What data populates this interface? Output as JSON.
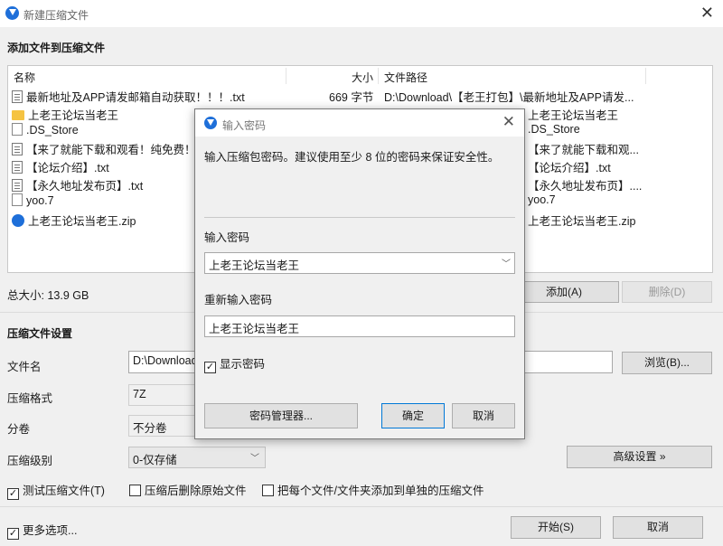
{
  "window": {
    "title": "新建压缩文件",
    "app_icon": "bandizip-icon",
    "close": "✕"
  },
  "files_section": {
    "title": "添加文件到压缩文件"
  },
  "columns": {
    "name": "名称",
    "size": "大小",
    "path": "文件路径"
  },
  "files": [
    {
      "icon": "text-file-icon",
      "name": "最新地址及APP请发邮箱自动获取！！！.txt",
      "size": "669 字节",
      "path": "D:\\Download\\【老王打包】\\最新地址及APP请发..."
    },
    {
      "icon": "folder-icon",
      "name": "上老王论坛当老王",
      "size": "",
      "path": "上老王论坛当老王"
    },
    {
      "icon": "blank-file-icon",
      "name": ".DS_Store",
      "size": "",
      "path": ".DS_Store"
    },
    {
      "icon": "text-file-icon",
      "name": "【来了就能下载和观看！纯免费！",
      "size": "",
      "path": "【来了就能下载和观..."
    },
    {
      "icon": "text-file-icon",
      "name": "【论坛介绍】.txt",
      "size": "",
      "path": "【论坛介绍】.txt"
    },
    {
      "icon": "text-file-icon",
      "name": "【永久地址发布页】.txt",
      "size": "",
      "path": "【永久地址发布页】...."
    },
    {
      "icon": "blank-file-icon",
      "name": "yoo.7",
      "size": "",
      "path": "yoo.7"
    },
    {
      "icon": "zip-file-icon",
      "name": "上老王论坛当老王.zip",
      "size": "",
      "path": "上老王论坛当老王.zip"
    }
  ],
  "total_size": "总大小: 13.9 GB",
  "buttons": {
    "add": "添加(A)",
    "delete": "删除(D)",
    "browse": "浏览(B)...",
    "advanced": "高级设置 »",
    "start": "开始(S)",
    "cancel": "取消"
  },
  "settings": {
    "title": "压缩文件设置",
    "filename_label": "文件名",
    "filename_value": "D:\\Download",
    "format_label": "压缩格式",
    "format_value": "7Z",
    "volume_label": "分卷",
    "volume_value": "不分卷",
    "level_label": "压缩级别",
    "level_value": "0-仅存储"
  },
  "options": {
    "test": {
      "label": "测试压缩文件(T)",
      "checked": true
    },
    "delete_original": {
      "label": "压缩后删除原始文件",
      "checked": false
    },
    "separate": {
      "label": "把每个文件/文件夹添加到单独的压缩文件",
      "checked": false
    },
    "more": {
      "label": "更多选项...",
      "checked": true
    }
  },
  "dialog": {
    "title": "输入密码",
    "message": "输入压缩包密码。建议使用至少 8 位的密码来保证安全性。",
    "password_label": "输入密码",
    "password_value": "上老王论坛当老王",
    "confirm_label": "重新输入密码",
    "confirm_value": "上老王论坛当老王",
    "show_password": {
      "label": "显示密码",
      "checked": true
    },
    "manager_button": "密码管理器...",
    "ok_button": "确定",
    "cancel_button": "取消"
  },
  "colors": {
    "accent": "#0078d7",
    "app_icon": "#1e6fd9",
    "folder": "#f5c342"
  }
}
